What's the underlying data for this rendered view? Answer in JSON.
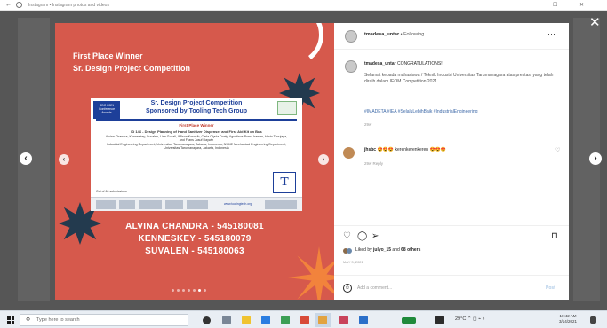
{
  "browser": {
    "url": "Instagram • Instagram photos and videos",
    "controls": [
      "—",
      "☐",
      "✕"
    ]
  },
  "modal": {
    "close_glyph": "✕",
    "prev_glyph": "‹",
    "next_glyph": "›"
  },
  "post_image": {
    "title_line1": "First Place Winner",
    "title_line2": "Sr. Design Project Competition",
    "names": [
      "ALVINA CHANDRA - 545180081",
      "KENNESKEY - 545180079",
      "SUVALEN - 545180063"
    ],
    "carousel": {
      "count": 7,
      "active_index": 5
    },
    "certificate": {
      "logo_text": "SDC 2021 Conference Awards",
      "heading1": "Sr. Design Project Competition",
      "heading2": "Sponsored by Tooling Tech Group",
      "place": "First Place Winner",
      "project": "ID 146 - Design Planning of Hand Sanitizer Dispenser and First Aid Kit on Bus",
      "authors": "Alvina Chandra, Kenneskey, Suvalen, Lina Gozali, Wilson Kosasih, Carla Olyvia Doaly, Agustinus Purna Irawan, Harto Tanujaya, and Frans Jusuf Daywin",
      "affiliation": "Industrial Engineering Department, Universitas Tarumanagara, Jakarta, Indonesia; 3/4ME Mechanical Engineering Department, Universitas Tarumanagara, Jakarta, Indonesia",
      "roll": "Out of 60 submissions",
      "tlogo": "T",
      "website": "www.toolingtech.org"
    }
  },
  "panel": {
    "header": {
      "username": "tmadesa_untar",
      "separator": " • ",
      "follow": "Following",
      "more": "···"
    },
    "caption": {
      "username": "tmadesa_untar",
      "text_short": "CONGRATULATIONS!",
      "body": "Selamat kepada mahasiswa / Teknik Industri Universitas Tarumanagara atas prestasi yang telah diraih dalam IEOM Competition 2021",
      "tags": "#IMADETA #IEA #SelaluLebihBaik #IndustrialEngineering",
      "time": "29w"
    },
    "comment": {
      "username": "jhsbc",
      "emoji1": "😍😍😍",
      "text": "kerenkerenkeren",
      "emoji2": "😍😍😍",
      "meta": "29w  Reply",
      "heart": "♡"
    },
    "actions": {
      "like": "♡",
      "comment": "◯",
      "share": "➢",
      "save": "⊓"
    },
    "likes": {
      "prefix": "Liked by ",
      "user": "julyo_15",
      "mid": " and ",
      "others": "68 others"
    },
    "likes_time": "MAY 3, 2021",
    "add_comment": {
      "smile": "☺",
      "placeholder": "Add a comment...",
      "post": "Post"
    }
  },
  "taskbar": {
    "search_placeholder": "Type here to search",
    "tray": "29°C  ⌃  ◻  ⌁  ♪",
    "time": "10:42 AM",
    "date": "3/14/2021"
  },
  "colors": {
    "post_bg": "#d6594c",
    "splat": "#233a4e",
    "accent": "#1d3f99",
    "link": "#3f6aa8"
  }
}
